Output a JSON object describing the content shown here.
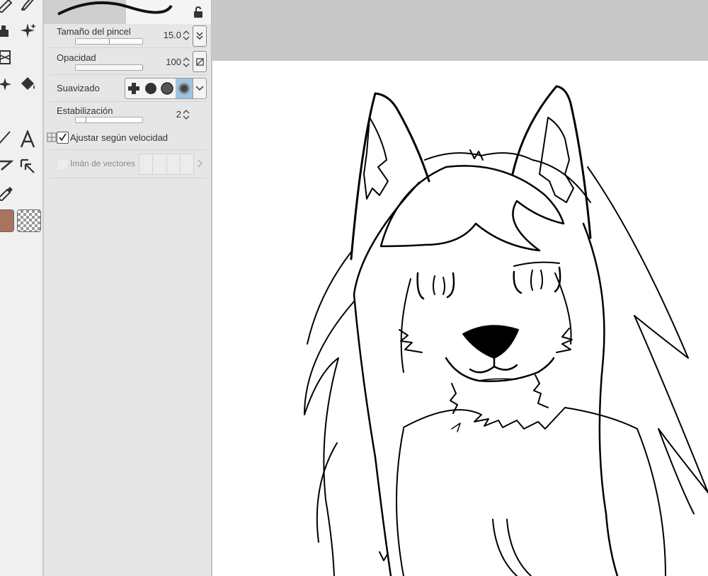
{
  "brush_settings": {
    "size": {
      "label": "Tamaño del pincel",
      "value": "15.0",
      "level": 0.5
    },
    "opacity": {
      "label": "Opacidad",
      "value": "100",
      "level": 1.0
    },
    "antialiasing": {
      "label": "Suavizado",
      "options": [
        "none-icon",
        "weak-icon",
        "medium-icon",
        "strong-icon"
      ],
      "selected": 3
    },
    "stabilization": {
      "label": "Estabilización",
      "value": "2",
      "level": 0.15
    },
    "speed_adjust": {
      "label": "Ajustar según velocidad",
      "checked": true
    },
    "vector_magnet": {
      "label": "Imán de vectores",
      "enabled": false
    }
  },
  "colors": {
    "main_color": "#a9735e",
    "selection_highlight": "#9cc3e6",
    "canvas_bg": "#ffffff",
    "workspace_bg": "#c8c8c8"
  },
  "tools": [
    "pen-icon",
    "brush-icon",
    "fill-icon",
    "sparkle-icon",
    "layers-icon",
    "blur-icon",
    "bucket-icon",
    "line-icon",
    "text-icon",
    "vector-icon",
    "select-icon",
    "eyedropper-icon"
  ]
}
